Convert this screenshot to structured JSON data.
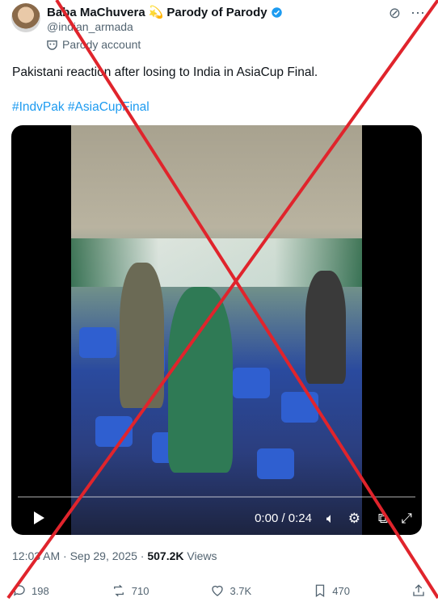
{
  "author": {
    "name": "Baba MaChuvera",
    "name_emoji": "💫",
    "name_suffix": "Parody of Parody",
    "handle": "@indian_armada",
    "label": "Parody account"
  },
  "tweet": {
    "text": "Pakistani reaction after losing to India in AsiaCup Final.",
    "hashtags": "#IndvPak #AsiaCupFinal"
  },
  "video": {
    "time": "0:00 / 0:24",
    "progress": 0
  },
  "meta": {
    "timestamp": "12:03 AM · Sep 29, 2025",
    "sep": "·",
    "views_count": "507.2K",
    "views_label": "Views"
  },
  "actions": {
    "replies": "198",
    "reposts": "710",
    "likes": "3.7K",
    "bookmarks": "470"
  },
  "colors": {
    "link": "#1d9bf0",
    "verified": "#1d9bf0",
    "overlay_cross": "#e0242c"
  }
}
